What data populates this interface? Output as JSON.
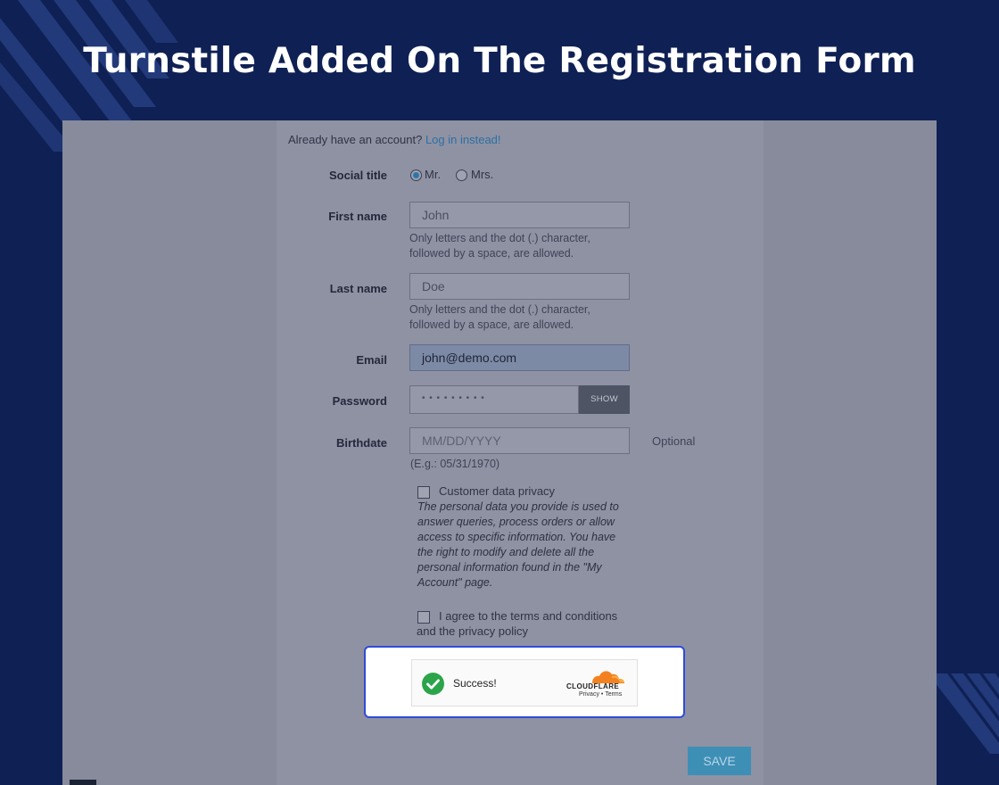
{
  "banner": {
    "title": "Turnstile Added On The Registration Form"
  },
  "form": {
    "login_prompt": "Already have an account?",
    "login_link": "Log in instead!",
    "social_title": {
      "label": "Social title",
      "options": [
        "Mr.",
        "Mrs."
      ],
      "selected": "Mr."
    },
    "first_name": {
      "label": "First name",
      "value": "John",
      "help_line1": "Only letters and the dot (.) character,",
      "help_line2": "followed by a space, are allowed."
    },
    "last_name": {
      "label": "Last name",
      "value": "Doe",
      "help_line1": "Only letters and the dot (.) character,",
      "help_line2": "followed by a space, are allowed."
    },
    "email": {
      "label": "Email",
      "value": "john@demo.com"
    },
    "password": {
      "label": "Password",
      "value": "• • • • • • • • •",
      "show_label": "SHOW"
    },
    "birthdate": {
      "label": "Birthdate",
      "placeholder": "MM/DD/YYYY",
      "optional": "Optional",
      "example": "(E.g.: 05/31/1970)"
    },
    "privacy": {
      "label": "Customer data privacy",
      "lines": [
        "The personal data you provide is used to",
        "answer queries, process orders or allow",
        "access to specific information. You have",
        "the right to modify and delete all the",
        "personal information found in the \"My",
        "Account\" page."
      ]
    },
    "terms": {
      "line1": "I agree to the terms and conditions",
      "line2": "and the privacy policy"
    },
    "save_label": "SAVE"
  },
  "turnstile": {
    "status": "Success!",
    "brand": "CLOUDFLARE",
    "privacy_link": "Privacy",
    "separator": "•",
    "terms_link": "Terms",
    "colors": {
      "success": "#2ca54a",
      "brand": "#f48120",
      "frame": "#2f4bd8"
    }
  }
}
